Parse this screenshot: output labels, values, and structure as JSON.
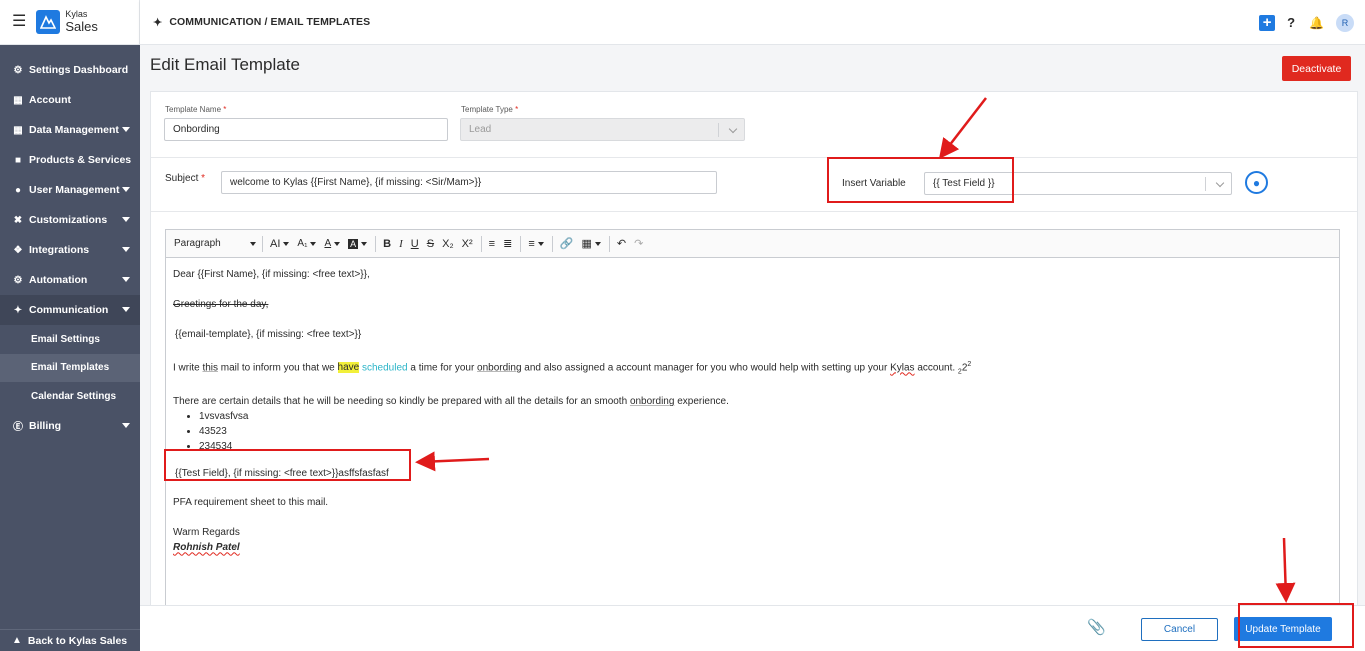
{
  "brand": {
    "name": "Kylas",
    "product": "Sales"
  },
  "header": {
    "breadcrumb": "COMMUNICATION / EMAIL TEMPLATES",
    "avatar_initial": "R"
  },
  "sidebar": {
    "items": [
      {
        "label": "Settings Dashboard",
        "icon": "gear-icon"
      },
      {
        "label": "Account",
        "icon": "account-icon"
      },
      {
        "label": "Data Management",
        "icon": "table-icon"
      },
      {
        "label": "Products & Services",
        "icon": "box-icon"
      },
      {
        "label": "User Management",
        "icon": "users-icon"
      },
      {
        "label": "Customizations",
        "icon": "tools-icon"
      },
      {
        "label": "Integrations",
        "icon": "plug-icon"
      },
      {
        "label": "Automation",
        "icon": "cogs-icon"
      },
      {
        "label": "Communication",
        "icon": "satellite-icon"
      },
      {
        "label": "Email Settings"
      },
      {
        "label": "Email Templates"
      },
      {
        "label": "Calendar Settings"
      },
      {
        "label": "Billing",
        "icon": "dollar-icon"
      }
    ],
    "back": "Back to Kylas Sales"
  },
  "page": {
    "title": "Edit Email Template",
    "deactivate": "Deactivate"
  },
  "form": {
    "template_name_label": "Template Name",
    "template_name_value": "Onbording",
    "template_type_label": "Template Type",
    "template_type_value": "Lead",
    "subject_label": "Subject",
    "subject_value": "welcome to Kylas {{First Name}, {if missing: <Sir/Mam>}}",
    "insert_variable_label": "Insert Variable",
    "insert_variable_value": "{{ Test Field }}",
    "required_mark": "*"
  },
  "toolbar": {
    "paragraph": "Paragraph"
  },
  "body": {
    "line1": "Dear {{First Name}, {if missing: <free text>}},",
    "line2": "Greetings for the day,",
    "line3": "{{email-template}, {if missing: <free text>}}",
    "line4_a": "I write ",
    "line4_this": "this",
    "line4_b": " mail to inform you that we ",
    "line4_have": "have",
    "line4_sp": " ",
    "line4_scheduled": "scheduled",
    "line4_c": " a time for your ",
    "line4_onbording": "onbording",
    "line4_d": " and also assigned a account manager for you who would help with setting up your ",
    "line4_kylas": "Kylas",
    "line4_e": " account. ",
    "line4_sub": "2",
    "line4_mid": "2",
    "line4_sup": "2",
    "line5_a": "There are certain details that he will be needing so kindly be prepared with all the details for an smooth ",
    "line5_onbording": "onbording",
    "line5_b": " experience.",
    "list": [
      "1vsvasfvsa",
      "43523",
      "234534"
    ],
    "line6": "{{Test Field}, {if missing: <free text>}}asffsfasfasf",
    "line7": "PFA requirement sheet to this mail.",
    "line8": "Warm Regards",
    "signature": "Rohnish Patel"
  },
  "footer": {
    "cancel": "Cancel",
    "update": "Update Template"
  },
  "colors": {
    "sidebar": "#4a5266",
    "primary": "#1f7ae0",
    "danger": "#e0291f",
    "annotation": "#e01b1b"
  }
}
